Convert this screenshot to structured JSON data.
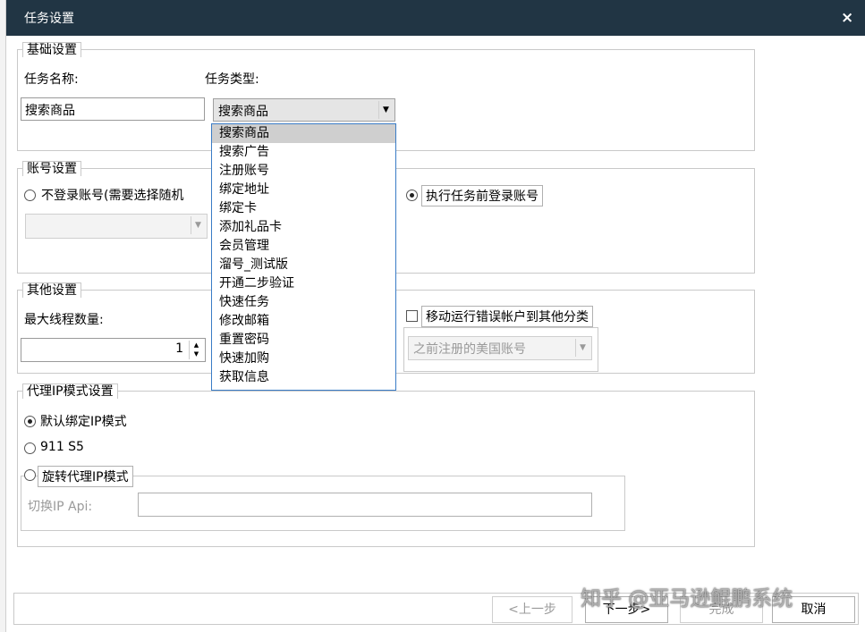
{
  "window": {
    "title": "任务设置",
    "close_glyph": "×"
  },
  "basic": {
    "legend": "基础设置",
    "task_name_label": "任务名称:",
    "task_name_value": "搜索商品",
    "task_type_label": "任务类型:",
    "task_type_value": "搜索商品",
    "task_type_options": [
      "搜索商品",
      "搜索广告",
      "注册账号",
      "绑定地址",
      "绑定卡",
      "添加礼品卡",
      "会员管理",
      "溜号_测试版",
      "开通二步验证",
      "快速任务",
      "修改邮箱",
      "重置密码",
      "快速加购",
      "获取信息"
    ],
    "selected_option": "搜索商品"
  },
  "account": {
    "legend": "账号设置",
    "no_login_label": "不登录账号(需要选择随机",
    "login_before_label": "执行任务前登录账号"
  },
  "other": {
    "legend": "其他设置",
    "max_threads_label": "最大线程数量:",
    "max_threads_value": "1",
    "move_error_label": "移动运行错误帐户到其他分类",
    "category_value": "之前注册的美国账号"
  },
  "proxy": {
    "legend": "代理IP模式设置",
    "default_bind_label": "默认绑定IP模式",
    "s5_label": "911 S5",
    "rotate_label": "旋转代理IP模式",
    "switch_api_label": "切换IP Api:",
    "switch_api_value": ""
  },
  "footer": {
    "prev": "<上一步",
    "next": "下一步>",
    "finish": "完成",
    "cancel": "取消"
  },
  "watermark": "知乎 @亚马逊鲲鹏系统"
}
